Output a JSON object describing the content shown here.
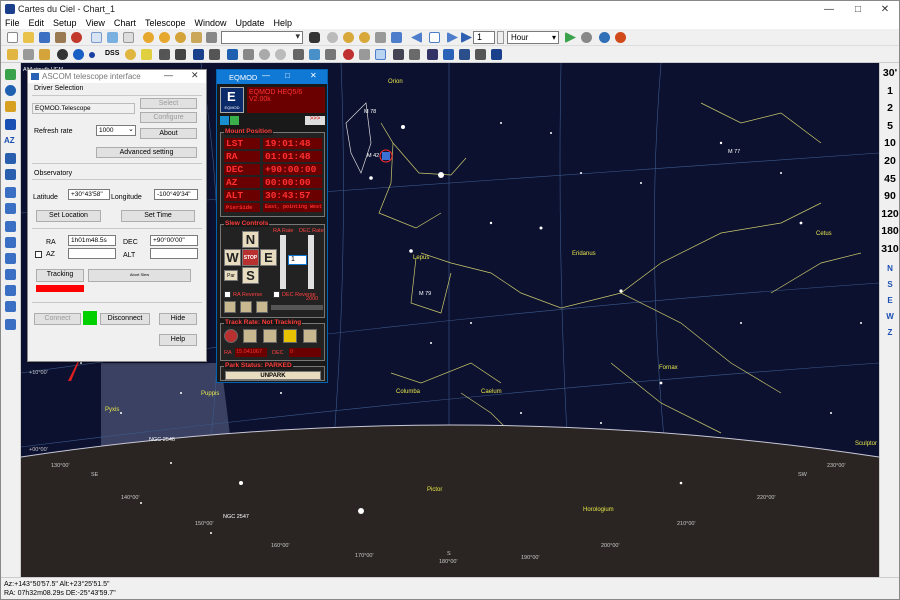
{
  "window": {
    "title": "Cartes du Ciel - Chart_1",
    "minimize": "—",
    "maximize": "□",
    "close": "✕"
  },
  "menu": [
    "File",
    "Edit",
    "Setup",
    "View",
    "Chart",
    "Telescope",
    "Window",
    "Update",
    "Help"
  ],
  "toolbar": {
    "step_value": "1",
    "time_unit": "Hour",
    "dss_label": "DSS"
  },
  "fov_buttons": [
    "30'",
    "1",
    "2",
    "5",
    "10",
    "20",
    "45",
    "90",
    "120",
    "180",
    "310"
  ],
  "direction_buttons": [
    "N",
    "S",
    "E",
    "W",
    "Z"
  ],
  "left_labels": [
    "AZ"
  ],
  "sky": {
    "constellations": [
      "Orion",
      "Lepus",
      "Eridanus",
      "Cetus",
      "Fornax",
      "Columba",
      "Caelum",
      "Puppis",
      "Pyxis",
      "Pictor",
      "Horologium",
      "Sculptor"
    ],
    "objects": [
      "M 42",
      "M 78",
      "M 79",
      "NGC 2546",
      "NGC 2547",
      "M 77"
    ],
    "horizon_dirs": [
      "SE",
      "S",
      "SW"
    ],
    "az_labels": [
      "130°00'",
      "140°00'",
      "150°00'",
      "160°00'",
      "170°00'",
      "180°00'",
      "190°00'",
      "200°00'",
      "210°00'",
      "220°00'",
      "230°00'"
    ],
    "dec_labels": [
      "+10°00'",
      "+00°00'"
    ],
    "topleft_text": "AltAzimuth HEM"
  },
  "status": {
    "line1": "Az:+143°50'57.5\" Alt:+23°25'51.5\"",
    "line2": "RA: 07h32m08.29s DE:-25°43'59.7\""
  },
  "ascom": {
    "title": "ASCOM telescope interface",
    "driver_selection": "Driver Selection",
    "driver": "EQMOD.Telescope",
    "select": "Select",
    "configure": "Configure",
    "about": "About",
    "refresh_rate_label": "Refresh rate",
    "refresh_rate": "1000",
    "advanced": "Advanced setting",
    "observatory": "Observatory",
    "latitude_label": "Latitude",
    "latitude": "+30°43'58\"",
    "longitude_label": "Longitude",
    "longitude": "-100°49'34\"",
    "set_location": "Set Location",
    "set_time": "Set Time",
    "ra_label": "RA",
    "ra": "1h01m48.5s",
    "dec_label": "DEC",
    "dec": "+90°00'00\"",
    "az_label": "AZ",
    "alt_label": "ALT",
    "tracking": "Tracking",
    "abort": "Abort Slew",
    "connect": "Connect",
    "disconnect": "Disconnect",
    "hide": "Hide",
    "help": "Help"
  },
  "eqmod": {
    "title": "EQMOD",
    "version": "EQMOD HEQ5/6",
    "version2": "V2.00k",
    "logo": "EQMOD",
    "mount_position": "Mount Position",
    "rows": [
      {
        "label": "LST",
        "value": "19:01:48"
      },
      {
        "label": "RA",
        "value": "01:01:48"
      },
      {
        "label": "DEC",
        "value": "+90:00:00"
      },
      {
        "label": "AZ",
        "value": "00:00:00"
      },
      {
        "label": "ALT",
        "value": "30:43:57"
      }
    ],
    "pier_label": "PierSide",
    "pier_value": "East, pointing West",
    "slew_controls": "Slew Controls",
    "ra_rate": "RA Rate",
    "dec_rate": "DEC Rate",
    "rate_value": "1",
    "n": "N",
    "s": "S",
    "e": "E",
    "w": "W",
    "stop": "STOP",
    "ra_reverse": "RA Reverse",
    "dec_reverse": "DEC Reverse",
    "small_value": "2000",
    "track_rate": "Track Rate: Not Tracking",
    "ra_small": "RA",
    "ra_track": "15.041067",
    "dec_small": "DEC",
    "dec_track": "0",
    "park_status": "Park Status: PARKED",
    "unpark": "UNPARK"
  },
  "colors": {
    "sky": "#0d1130",
    "ground": "#2a2522",
    "lines": "#c9c96a",
    "grid": "#3b5a8a",
    "accent": "#1079d6",
    "connected": "#00d000",
    "eqmod_red": "#ff3030"
  }
}
